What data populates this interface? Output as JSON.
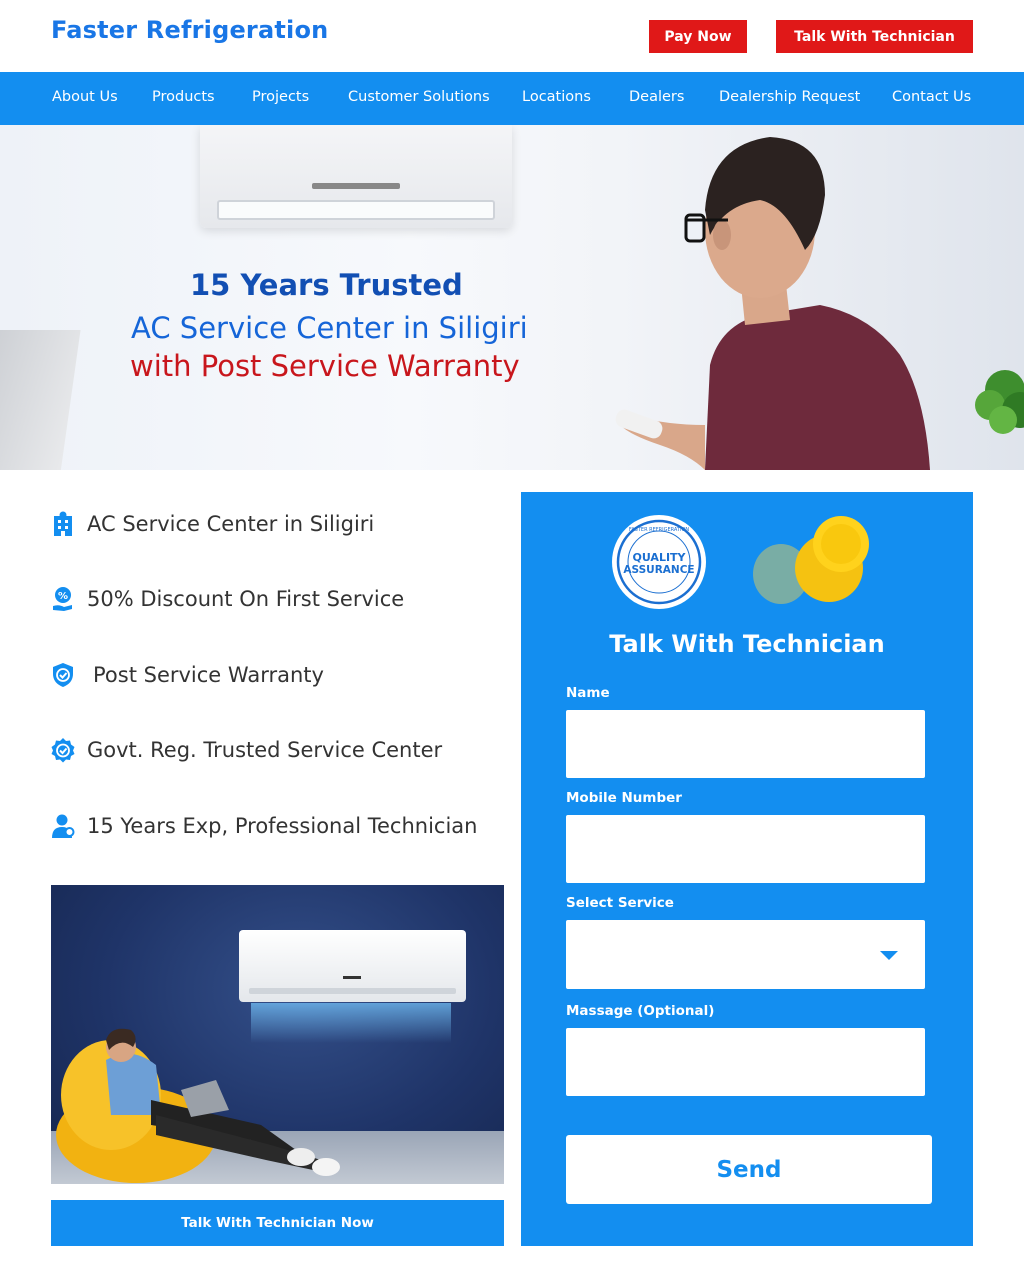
{
  "header": {
    "logo": "Faster Refrigeration",
    "pay_now_label": "Pay Now",
    "talk_technician_label": "Talk With Technician"
  },
  "nav": {
    "items": [
      {
        "label": "About Us"
      },
      {
        "label": "Products"
      },
      {
        "label": "Projects"
      },
      {
        "label": "Customer Solutions"
      },
      {
        "label": "Locations"
      },
      {
        "label": "Dealers"
      },
      {
        "label": "Dealership Request"
      },
      {
        "label": "Contact Us"
      }
    ]
  },
  "hero": {
    "line1": "15 Years Trusted",
    "line2": "AC Service Center in Siligiri",
    "line3": "with Post Service Warranty"
  },
  "features": [
    {
      "text": "AC Service Center in Siligiri",
      "icon": "building-icon"
    },
    {
      "text": "50% Discount On First Service",
      "icon": "discount-hand-icon"
    },
    {
      "text": "Post Service Warranty",
      "icon": "shield-check-icon"
    },
    {
      "text": "Govt. Reg. Trusted Service Center",
      "icon": "badge-check-icon"
    },
    {
      "text": "15 Years Exp, Professional Technician",
      "icon": "technician-icon"
    }
  ],
  "promo": {
    "button_label": "Talk With Technician Now"
  },
  "form": {
    "badge_top_text": "FASTER REFRIGERATION",
    "badge_line1": "QUALITY",
    "badge_line2": "ASSURANCE",
    "title": "Talk With Technician",
    "name_label": "Name",
    "name_value": "",
    "mobile_label": "Mobile Number",
    "mobile_value": "",
    "service_label": "Select Service",
    "service_value": "",
    "message_label": "Massage (Optional)",
    "message_value": "",
    "send_label": "Send"
  },
  "colors": {
    "brand_blue": "#138ef0",
    "logo_blue": "#1976e6",
    "accent_red": "#e01818",
    "hero_red": "#c8161c"
  }
}
